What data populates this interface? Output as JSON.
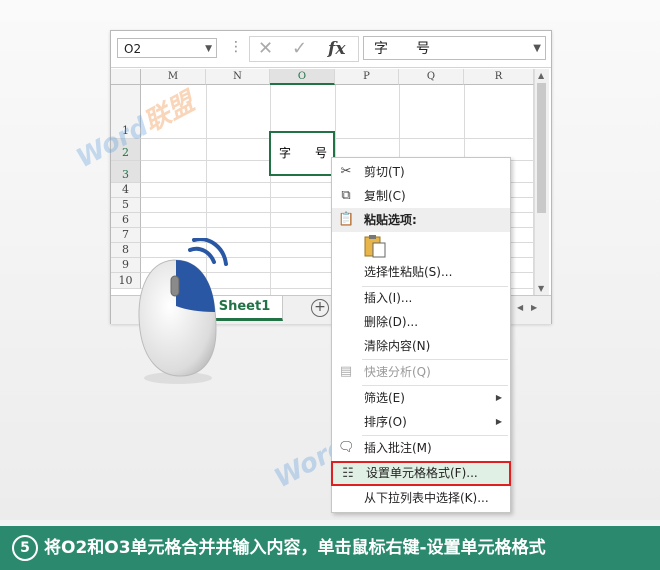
{
  "namebox": {
    "value": "O2"
  },
  "formula": {
    "fx": "fx",
    "value": "字　　号"
  },
  "columns": [
    "M",
    "N",
    "O",
    "P",
    "Q",
    "R"
  ],
  "rows": [
    "1",
    "2",
    "3",
    "4",
    "5",
    "6",
    "7",
    "8",
    "9",
    "10"
  ],
  "cell_o2": {
    "left": "字",
    "right": "号"
  },
  "sheet_tab": "Sheet1",
  "context_menu": {
    "cut": "剪切(T)",
    "copy": "复制(C)",
    "paste_options": "粘贴选项:",
    "paste_special": "选择性粘贴(S)...",
    "insert": "插入(I)...",
    "delete": "删除(D)...",
    "clear": "清除内容(N)",
    "quick_analysis": "快速分析(Q)",
    "filter": "筛选(E)",
    "sort": "排序(O)",
    "insert_comment": "插入批注(M)",
    "format_cells": "设置单元格格式(F)...",
    "pick_list": "从下拉列表中选择(K)..."
  },
  "watermark": {
    "word": "Word",
    "brand": "联盟"
  },
  "footer": {
    "step": "5",
    "text": "将O2和O3单元格合并并输入内容，单击鼠标右键-设置单元格格式"
  },
  "colors": {
    "excel_green": "#217346",
    "highlight_red": "#e02020",
    "footer_bg": "#2b8a6e",
    "mouse_blue": "#2a57a3"
  }
}
